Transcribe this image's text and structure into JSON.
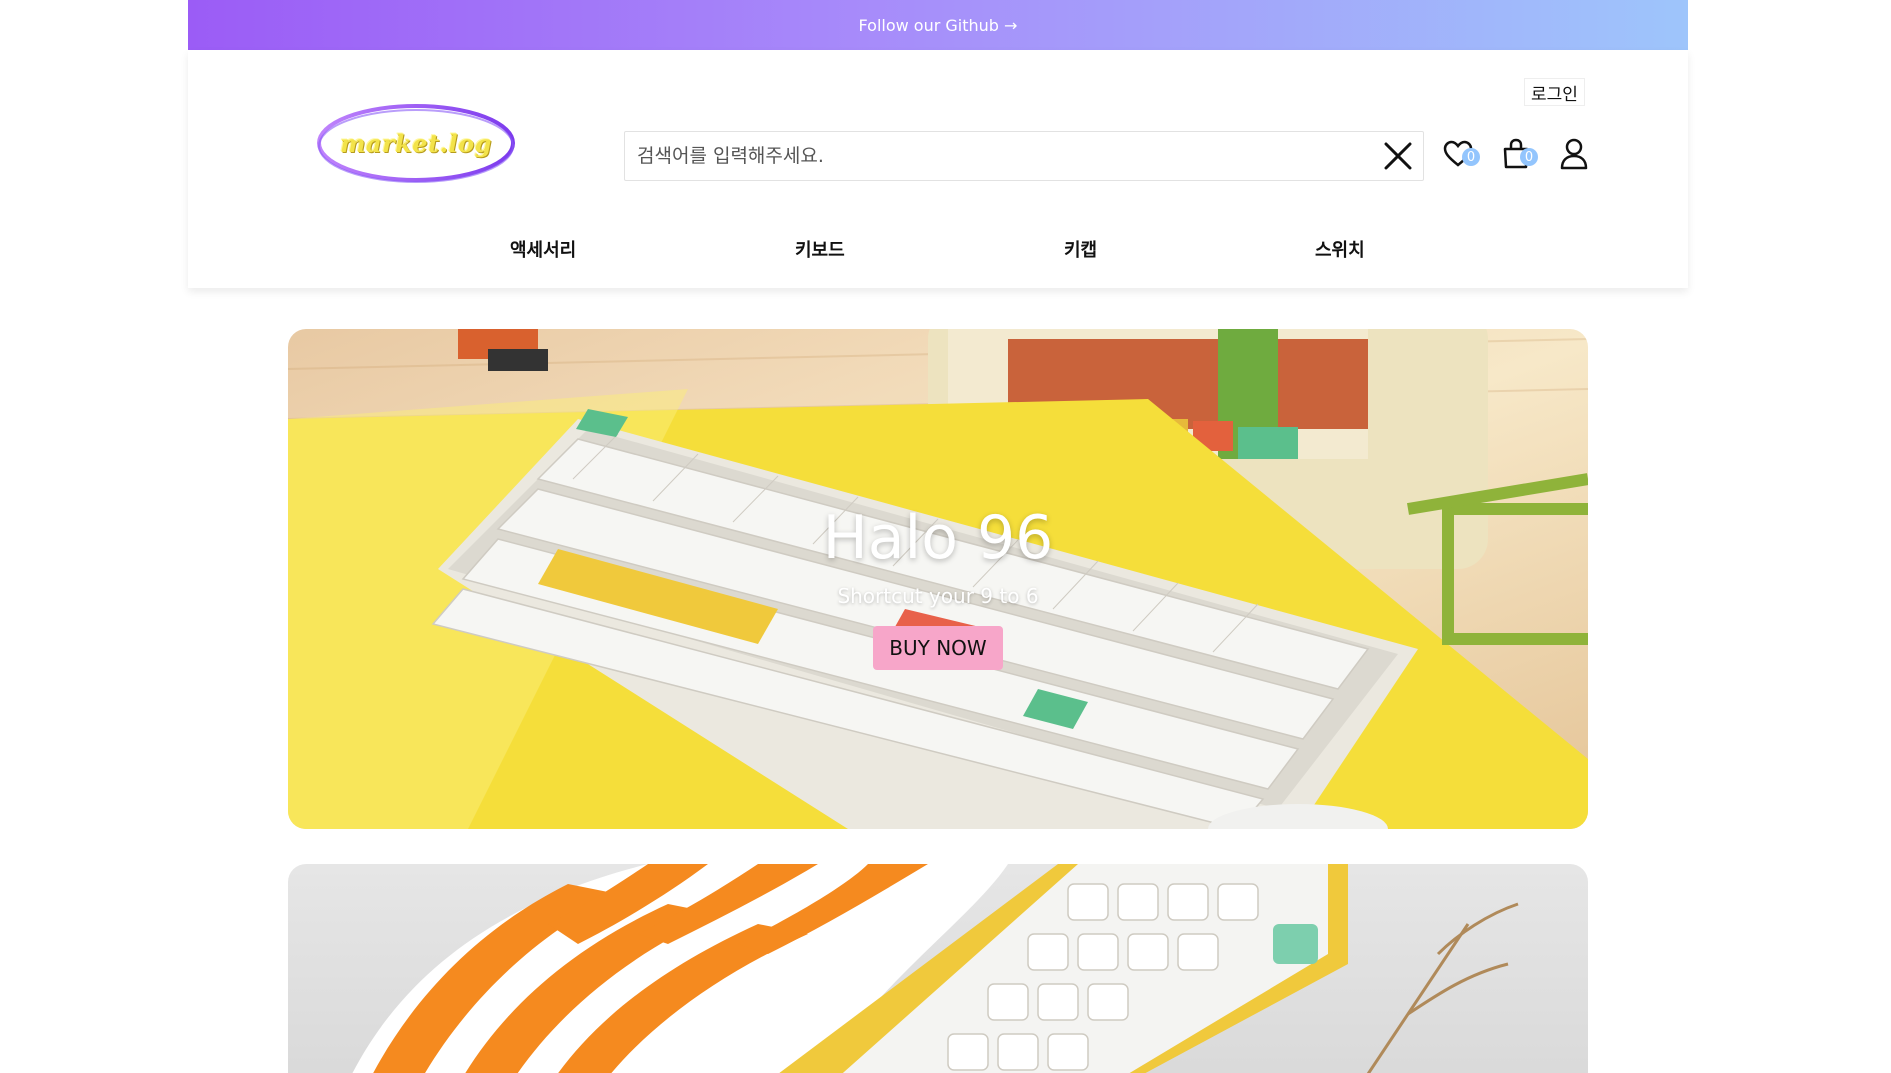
{
  "topbar": {
    "link_text": "Follow our Github →"
  },
  "header": {
    "logo_text": "market.log",
    "login_label": "로그인",
    "search": {
      "placeholder": "검색어를 입력해주세요."
    },
    "wishlist_count": "0",
    "cart_count": "0"
  },
  "nav": {
    "items": [
      {
        "label": "액세서리"
      },
      {
        "label": "키보드"
      },
      {
        "label": "키캡"
      },
      {
        "label": "스위치"
      }
    ]
  },
  "hero": {
    "title": "Halo 96",
    "subtitle": "Shortcut your 9 to 6",
    "button_label": "BUY NOW"
  },
  "colors": {
    "topbar_gradient_start": "#9b5cf6",
    "topbar_gradient_end": "#9ec5fb",
    "badge": "#93c5fd",
    "hero_button": "#f7a6c9",
    "mousepad": "#f5de3a"
  },
  "icons": [
    "close-icon",
    "heart-icon",
    "shopping-bag-icon",
    "user-icon"
  ]
}
